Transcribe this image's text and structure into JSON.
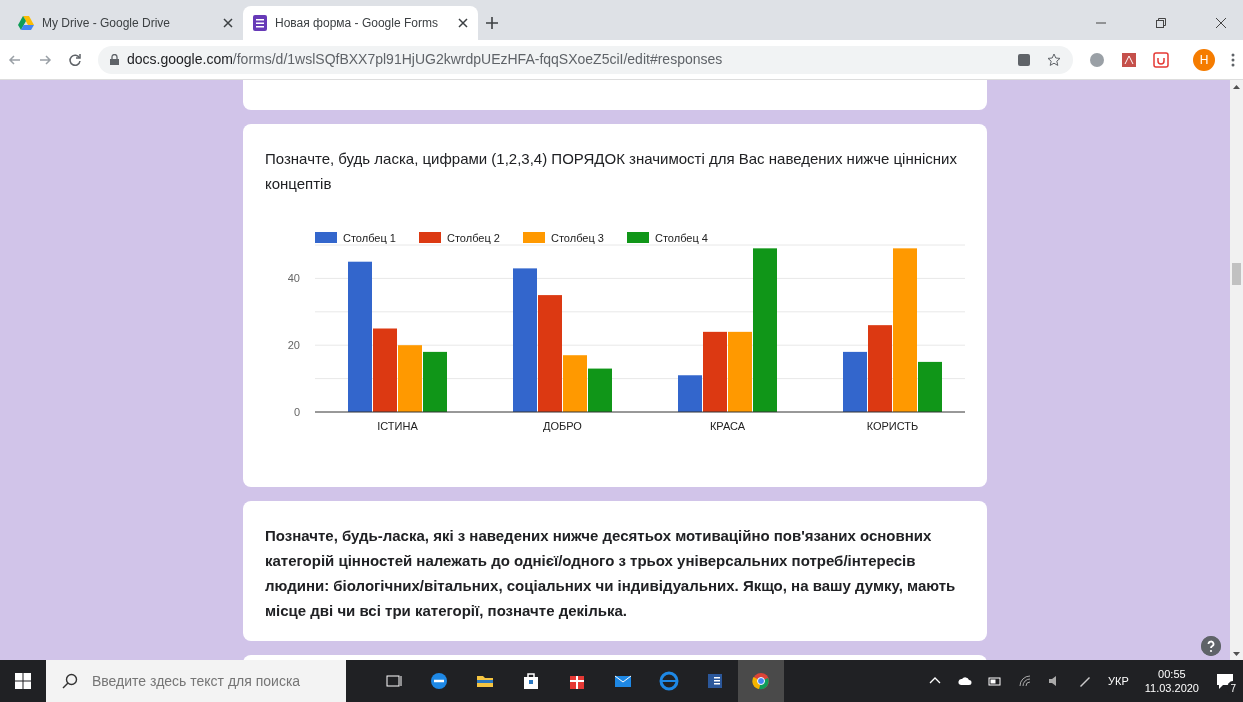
{
  "browser": {
    "tabs": [
      {
        "title": "My Drive - Google Drive",
        "selected": false
      },
      {
        "title": "Новая форма - Google Forms",
        "selected": true
      }
    ],
    "address": {
      "host": "docs.google.com",
      "path": "/forms/d/1wslSQfBXX7pl91HjUG2kwrdpUEzHFA-fqqSXoeZ5ciI/edit#responses"
    },
    "profile_initial": "H"
  },
  "form": {
    "cards": [
      {
        "kind": "cut"
      },
      {
        "kind": "chart",
        "question": "Позначте, будь ласка, цифрами (1,2,3,4) ПОРЯДОК значимості для Вас наведених нижче ціннісних концептів",
        "chart_data": {
          "type": "bar",
          "categories": [
            "ІСТИНА",
            "ДОБРО",
            "КРАСА",
            "КОРИСТЬ"
          ],
          "series": [
            {
              "name": "Столбец 1",
              "color": "#3366cc",
              "values": [
                45,
                43,
                11,
                18
              ]
            },
            {
              "name": "Столбец 2",
              "color": "#dc3912",
              "values": [
                25,
                35,
                24,
                26
              ]
            },
            {
              "name": "Столбец 3",
              "color": "#ff9900",
              "values": [
                20,
                17,
                24,
                49
              ]
            },
            {
              "name": "Столбец 4",
              "color": "#109618",
              "values": [
                18,
                13,
                49,
                15
              ]
            }
          ],
          "ylim": [
            0,
            50
          ],
          "yticks": [
            0,
            20,
            40
          ],
          "legend": "top"
        }
      },
      {
        "kind": "text",
        "question": "Позначте, будь-ласка, які з наведених нижче десятьох мотиваційно пов'язаних основних категорій цінностей належать до однієї/одного з трьох універсальних потреб/інтересів людини: біологічних/вітальних, соціальних чи індивідуальних. Якщо, на вашу думку, мають місце дві чи всі три категорії, позначте декілька."
      },
      {
        "kind": "cut"
      }
    ]
  },
  "taskbar": {
    "search_placeholder": "Введите здесь текст для поиска",
    "language": "УКР",
    "time": "00:55",
    "date": "11.03.2020",
    "notifications": "7"
  }
}
